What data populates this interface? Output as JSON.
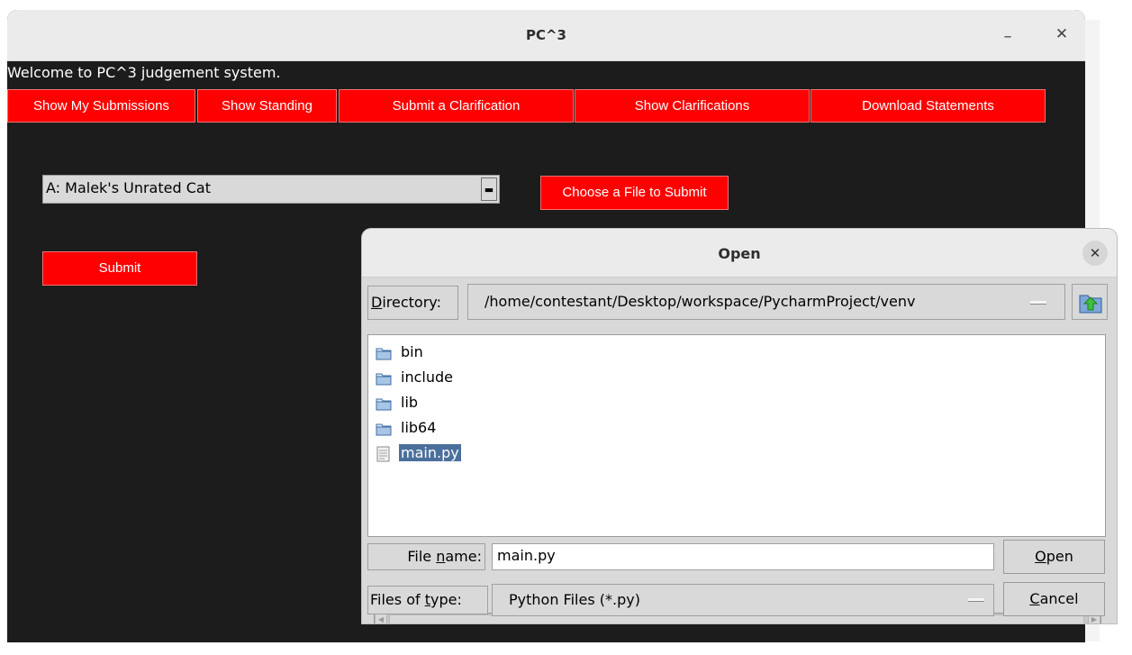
{
  "main_window": {
    "title": "PC^3",
    "minimize_glyph": "–",
    "close_glyph": "✕",
    "welcome": "Welcome to PC^3 judgement system.",
    "nav": [
      {
        "label": "Show My Submissions"
      },
      {
        "label": "Show Standing"
      },
      {
        "label": "Submit a Clarification"
      },
      {
        "label": "Show Clarifications"
      },
      {
        "label": "Download Statements"
      }
    ],
    "problem_select": {
      "value": "A: Malek's Unrated Cat"
    },
    "choose_file_label": "Choose a File to Submit",
    "submit_label": "Submit",
    "button_color": "#ff0000"
  },
  "dialog": {
    "title": "Open",
    "close_glyph": "✕",
    "directory_label_pre": "",
    "directory_label_u": "D",
    "directory_label_post": "irectory:",
    "directory_value": "/home/contestant/Desktop/workspace/PycharmProject/venv",
    "files": [
      {
        "name": "bin",
        "icon": "folder-icon"
      },
      {
        "name": "include",
        "icon": "folder-icon"
      },
      {
        "name": "lib",
        "icon": "folder-icon"
      },
      {
        "name": "lib64",
        "icon": "folder-icon"
      },
      {
        "name": "main.py",
        "icon": "file-icon",
        "selected": true
      }
    ],
    "file_name_label_pre": "File ",
    "file_name_label_u": "n",
    "file_name_label_post": "ame:",
    "file_name_value": "main.py",
    "open_label_u": "O",
    "open_label_post": "pen",
    "files_of_type_label_pre": "Files of ",
    "files_of_type_label_u": "t",
    "files_of_type_label_post": "ype:",
    "files_of_type_value": "Python Files (*.py)",
    "cancel_label_u": "C",
    "cancel_label_post": "ancel",
    "selection_color": "#4a6f9b"
  }
}
